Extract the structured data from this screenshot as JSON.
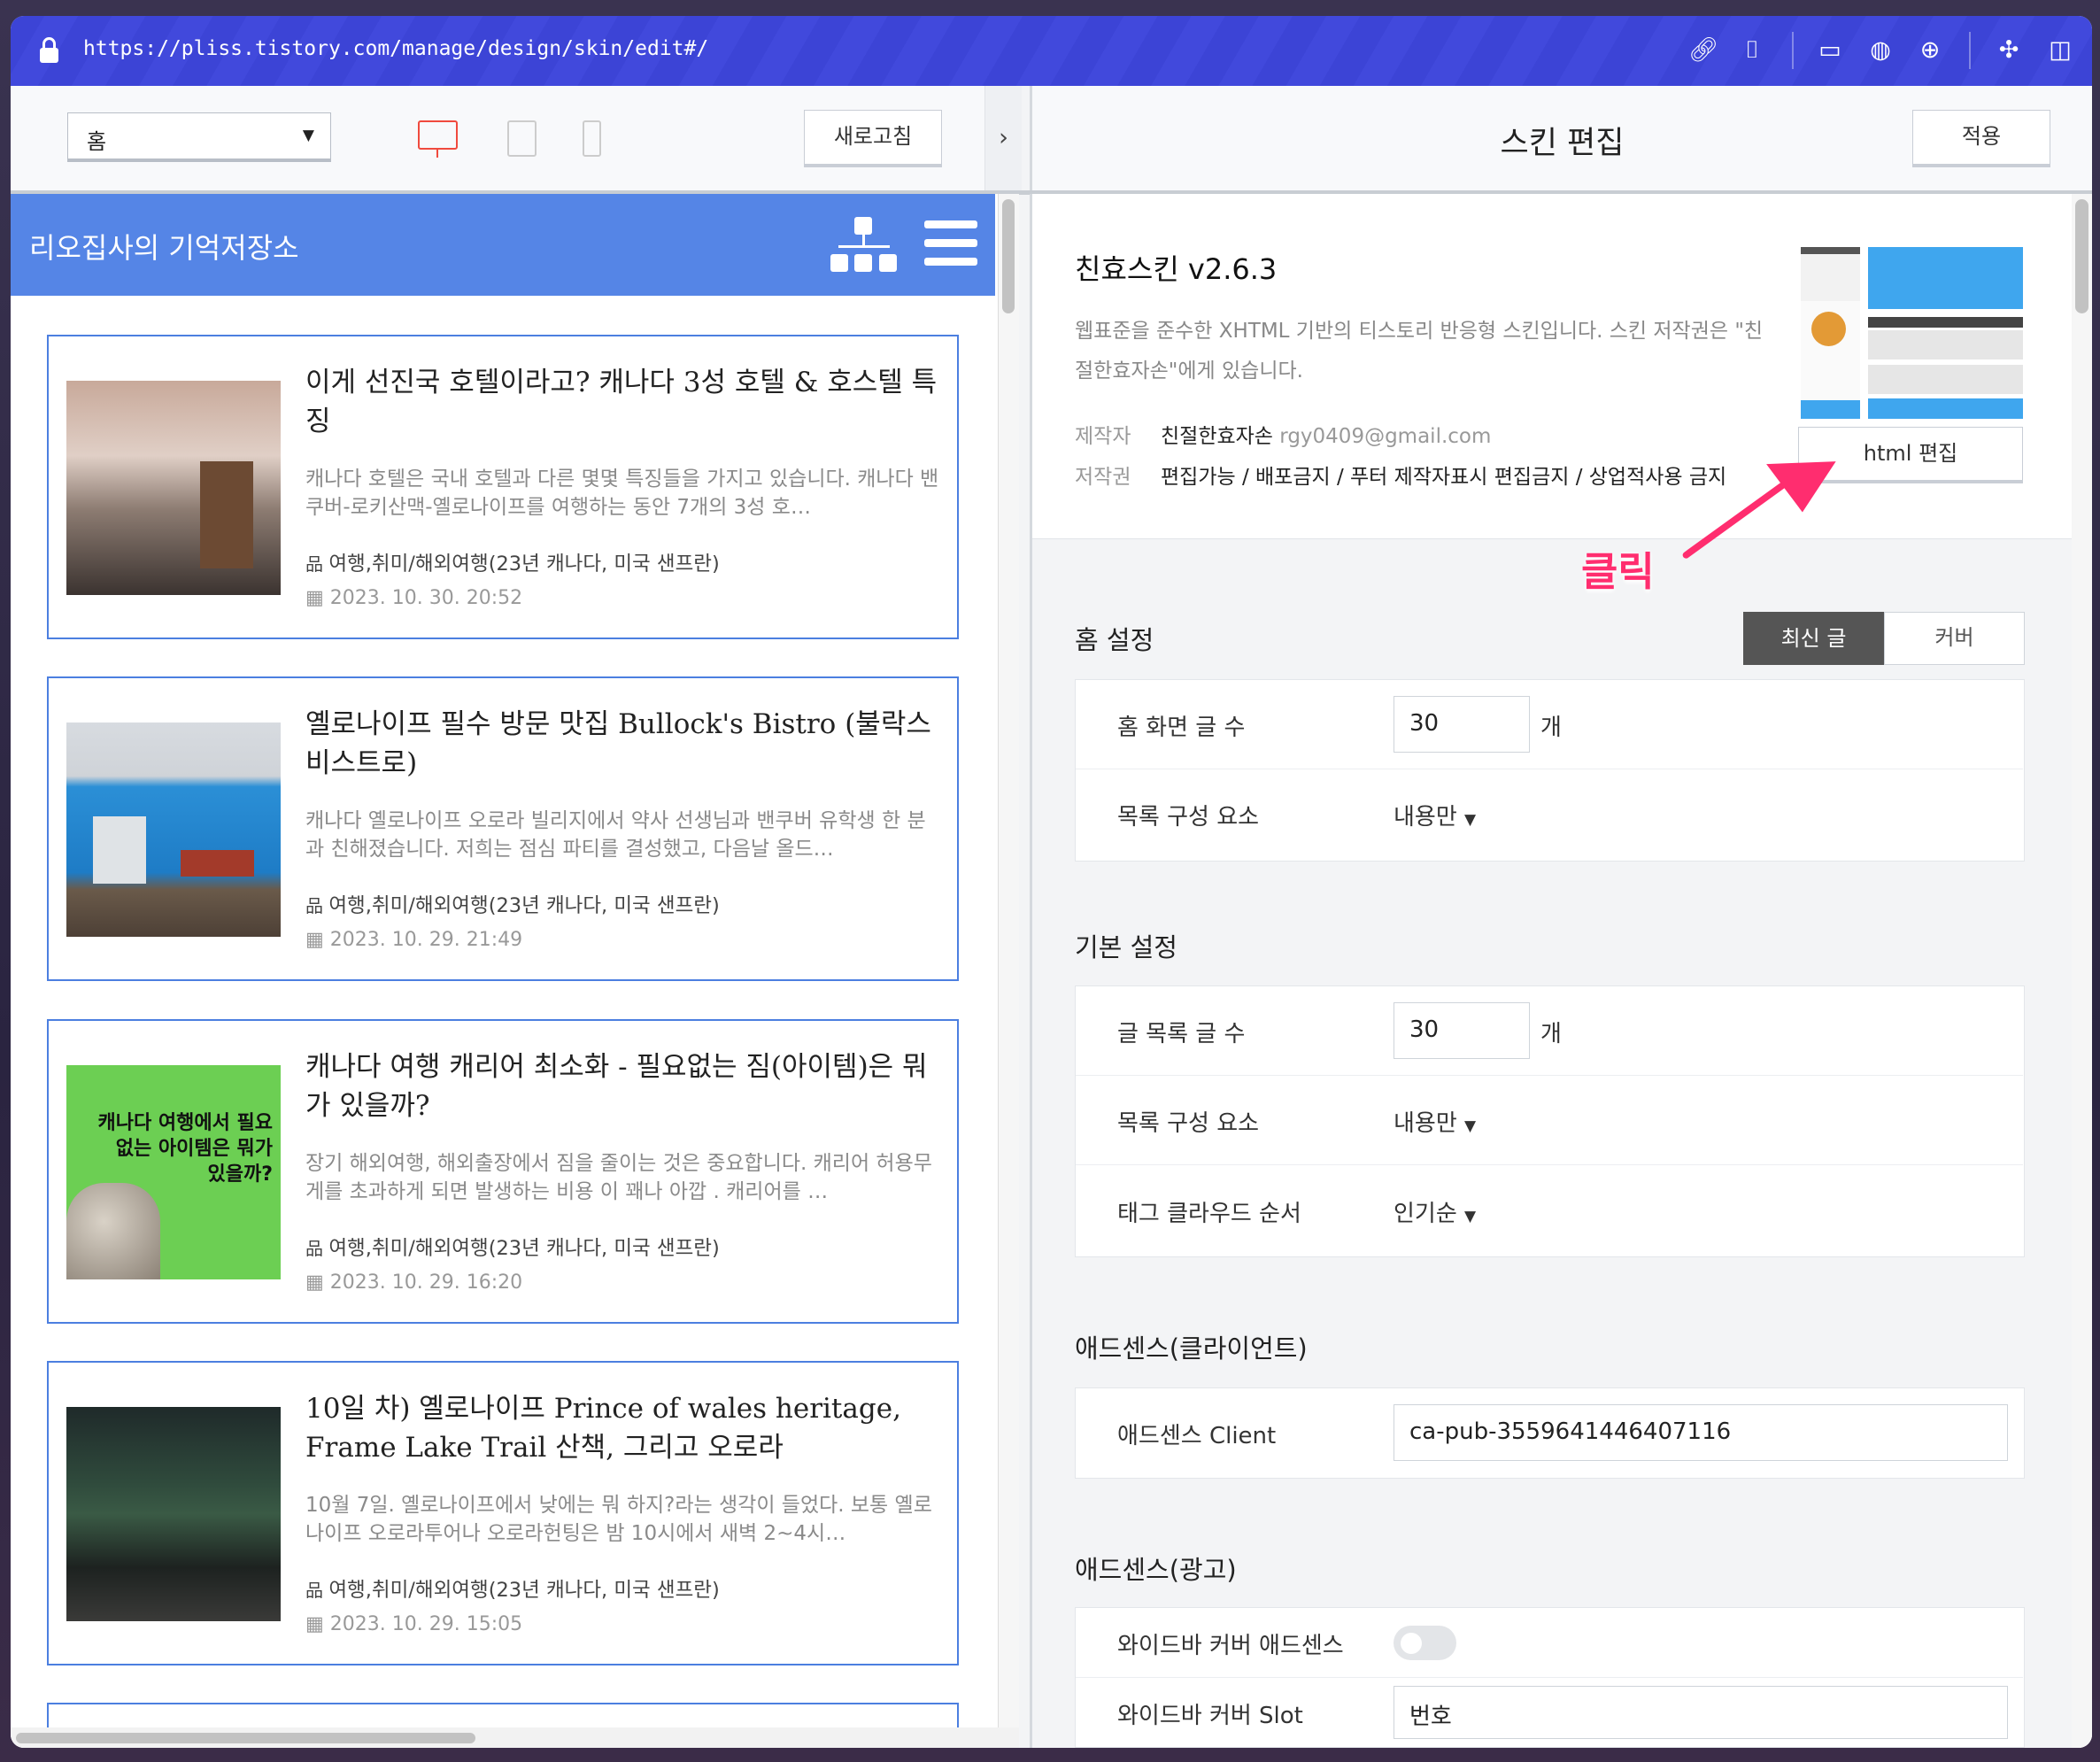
{
  "browser": {
    "url": "https://pliss.tistory.com/manage/design/skin/edit#/",
    "icons": [
      "link-icon",
      "camera-icon",
      "terminal-icon",
      "globe-icon",
      "crosshair-icon",
      "extension-icon",
      "sidebar-icon"
    ]
  },
  "preview_toolbar": {
    "page_select": "홈",
    "refresh_label": "새로고침",
    "devices": [
      "desktop",
      "tablet",
      "mobile"
    ]
  },
  "editor_toolbar": {
    "title": "스킨 편집",
    "apply_label": "적용"
  },
  "blog": {
    "title": "리오집사의 기억저장소",
    "posts": [
      {
        "title": "이게 선진국 호텔이라고? 캐나다 3성 호텔 & 호스텔 특징",
        "excerpt": "캐나다 호텔은 국내 호텔과 다른 몇몇 특징들을 가지고 있습니다. 캐나다 밴쿠버-로키산맥-옐로나이프를 여행하는 동안 7개의 3성 호…",
        "category": "여행,취미/해외여행(23년 캐나다, 미국 샌프란)",
        "date": "2023. 10. 30. 20:52"
      },
      {
        "title": "옐로나이프 필수 방문 맛집 Bullock's Bistro (불락스 비스트로)",
        "excerpt": "캐나다 옐로나이프 오로라 빌리지에서 약사 선생님과 밴쿠버 유학생 한 분과 친해졌습니다. 저희는 점심 파티를 결성했고, 다음날 올드…",
        "category": "여행,취미/해외여행(23년 캐나다, 미국 샌프란)",
        "date": "2023. 10. 29. 21:49"
      },
      {
        "title": "캐나다 여행 캐리어 최소화 - 필요없는 짐(아이템)은 뭐가 있을까?",
        "excerpt": "장기 해외여행, 해외출장에서 짐을 줄이는 것은 중요합니다. 캐리어 허용무게를 초과하게 되면 발생하는 비용 이 꽤나 아깝 . 캐리어를 …",
        "category": "여행,취미/해외여행(23년 캐나다, 미국 샌프란)",
        "date": "2023. 10. 29. 16:20",
        "thumb_text": "캐나다 여행에서 필요없는 아이템은 뭐가 있을까?"
      },
      {
        "title": "10일 차) 옐로나이프 Prince of wales heritage, Frame Lake Trail 산책, 그리고 오로라",
        "excerpt": "10월 7일. 옐로나이프에서 낮에는 뭐 하지?라는 생각이 들었다. 보통 옐로나이프 오로라투어나 오로라헌팅은 밤 10시에서 새벽 2~4시…",
        "category": "여행,취미/해외여행(23년 캐나다, 미국 샌프란)",
        "date": "2023. 10. 29. 15:05"
      }
    ]
  },
  "skin": {
    "name": "친효스킨 v2.6.3",
    "description": "웹표준을 준수한 XHTML 기반의 티스토리 반응형 스킨입니다. 스킨 저작권은 \"친절한효자손\"에게 있습니다.",
    "maker_label": "제작자",
    "maker": "친절한효자손",
    "email": "rgy0409@gmail.com",
    "copyright_label": "저작권",
    "copyright": "편집가능 / 배포금지 / 푸터 제작자표시 편집금지 / 상업적사용 금지",
    "html_edit_label": "html 편집"
  },
  "annotation": {
    "text": "클릭",
    "color": "#ff2d6f"
  },
  "home_settings": {
    "title": "홈 설정",
    "tabs": [
      "최신 글",
      "커버"
    ],
    "active_tab": "최신 글",
    "post_count_label": "홈 화면 글 수",
    "post_count": "30",
    "unit": "개",
    "list_label": "목록 구성 요소",
    "list_value": "내용만"
  },
  "basic_settings": {
    "title": "기본 설정",
    "post_count_label": "글 목록 글 수",
    "post_count": "30",
    "unit": "개",
    "list_label": "목록 구성 요소",
    "list_value": "내용만",
    "tag_label": "태그 클라우드 순서",
    "tag_value": "인기순"
  },
  "adsense_client": {
    "title": "애드센스(클라이언트)",
    "label": "애드센스 Client",
    "value": "ca-pub-3559641446407116"
  },
  "adsense_ads": {
    "title": "애드센스(광고)",
    "toggle_label": "와이드바 커버 애드센스",
    "toggle_on": false,
    "slot_label": "와이드바 커버 Slot",
    "slot_value": "번호"
  }
}
